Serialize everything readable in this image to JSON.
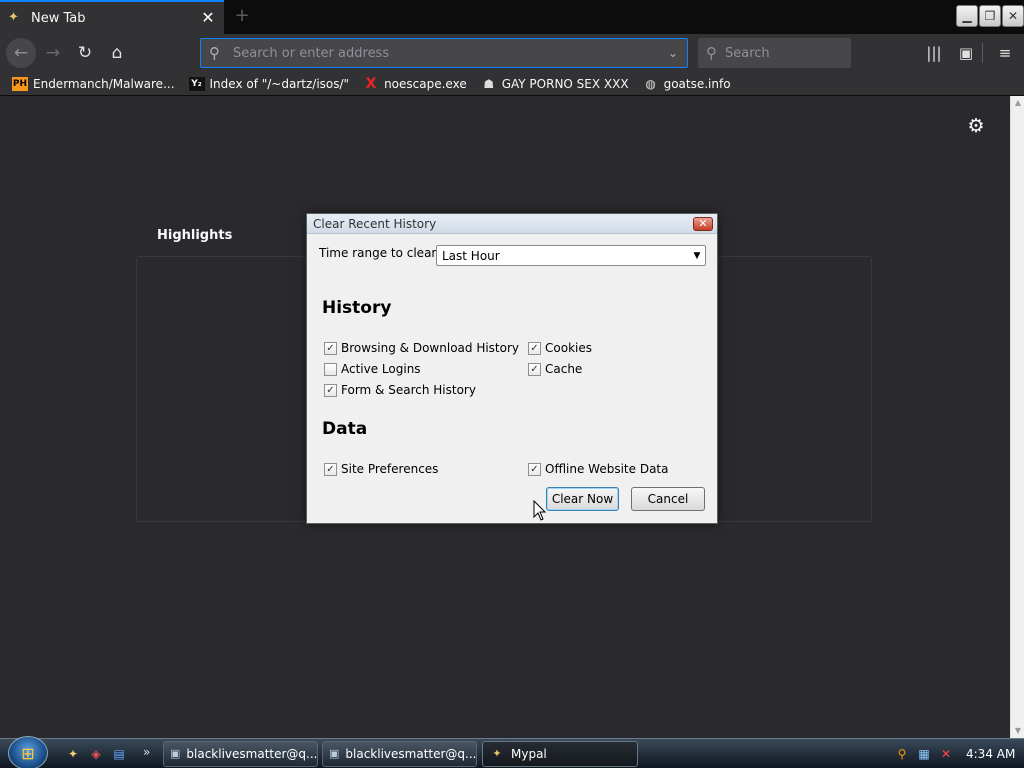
{
  "browser": {
    "tab": {
      "title": "New Tab"
    },
    "urlbar": {
      "placeholder": "Search or enter address"
    },
    "searchbar": {
      "placeholder": "Search"
    }
  },
  "bookmarks": [
    {
      "label": "Endermanch/Malware...",
      "icon": "PH"
    },
    {
      "label": "Index of \"/~dartz/isos/\"",
      "icon": "Y₂"
    },
    {
      "label": "noescape.exe",
      "icon": "X"
    },
    {
      "label": "GAY PORNO SEX XXX",
      "icon": ""
    },
    {
      "label": "goatse.info",
      "icon": ""
    }
  ],
  "newtab": {
    "section_title": "Highlights"
  },
  "dialog": {
    "title": "Clear Recent History",
    "range_label": "Time range to clear:",
    "range_value": "Last Hour",
    "history_title": "History",
    "data_title": "Data",
    "history_items": [
      {
        "label": "Browsing & Download History",
        "checked": true
      },
      {
        "label": "Cookies",
        "checked": true
      },
      {
        "label": "Active Logins",
        "checked": false
      },
      {
        "label": "Cache",
        "checked": true
      },
      {
        "label": "Form & Search History",
        "checked": true
      }
    ],
    "data_items": [
      {
        "label": "Site Preferences",
        "checked": true
      },
      {
        "label": "Offline Website Data",
        "checked": true
      }
    ],
    "clear_button": "Clear Now",
    "cancel_button": "Cancel"
  },
  "taskbar": {
    "tasks": [
      {
        "label": "blacklivesmatter@q..."
      },
      {
        "label": "blacklivesmatter@q..."
      },
      {
        "label": "Mypal"
      }
    ],
    "clock": "4:34 AM"
  },
  "colors": {
    "accent": "#0a84ff",
    "toolbar": "#323234",
    "content_bg": "#2a2a2e"
  }
}
